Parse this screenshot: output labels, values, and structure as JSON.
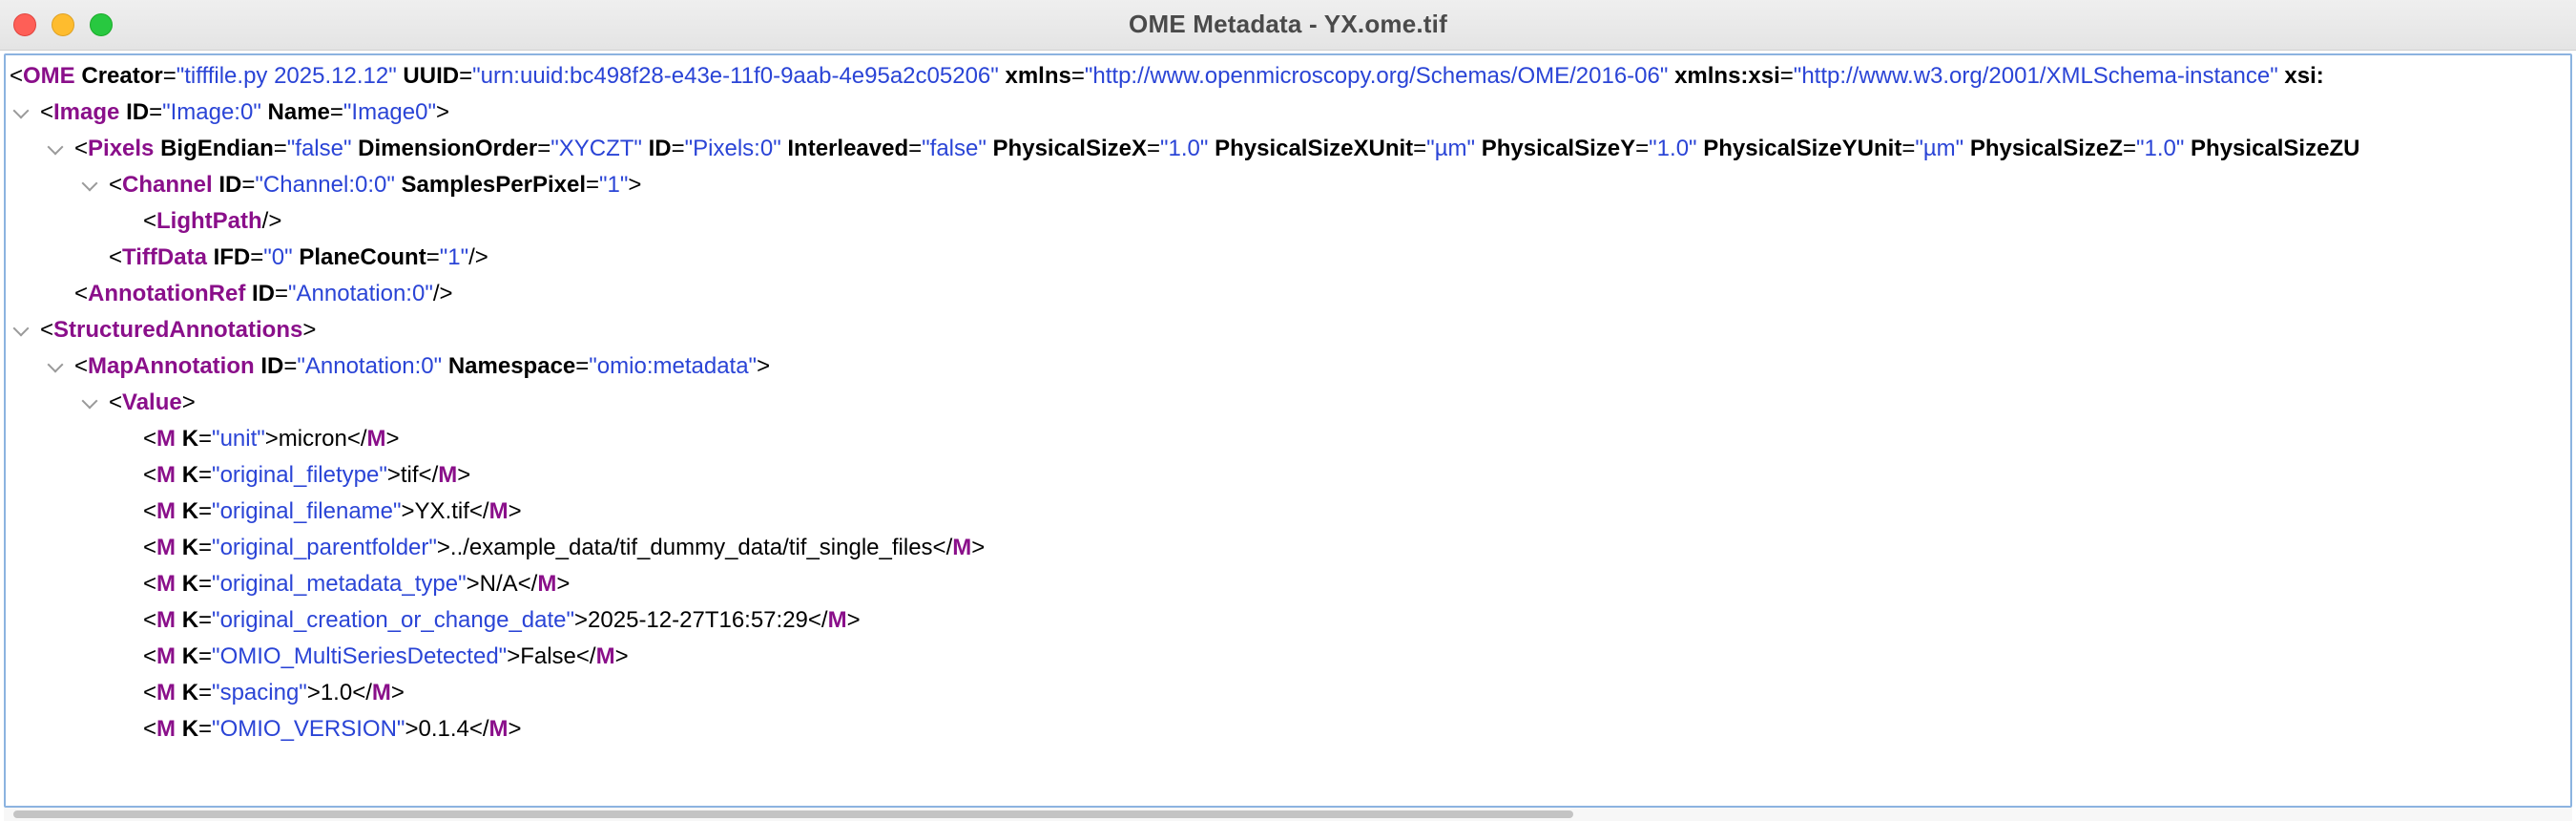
{
  "window": {
    "title": "OME Metadata - YX.ome.tif"
  },
  "icons": {
    "expand": "chevron-down-icon"
  },
  "colors": {
    "tag": "#8a0f8a",
    "attr_value": "#2a44d6",
    "focus_border": "#8cb3e0"
  },
  "tree": {
    "ome": {
      "name": "OME",
      "creator_attr": "Creator",
      "creator_val": "\"tifffile.py 2025.12.12\"",
      "uuid_attr": "UUID",
      "uuid_val": "\"urn:uuid:bc498f28-e43e-11f0-9aab-4e95a2c05206\"",
      "xmlns_attr": "xmlns",
      "xmlns_val": "\"http://www.openmicroscopy.org/Schemas/OME/2016-06\"",
      "xmlnsxsi_attr": "xmlns:xsi",
      "xmlnsxsi_val": "\"http://www.w3.org/2001/XMLSchema-instance\"",
      "xsi_attr": "xsi:"
    },
    "image": {
      "name": "Image",
      "id_attr": "ID",
      "id_val": "\"Image:0\"",
      "name_attr": "Name",
      "name_val": "\"Image0\""
    },
    "pixels": {
      "name": "Pixels",
      "bigendian_attr": "BigEndian",
      "bigendian_val": "\"false\"",
      "dimorder_attr": "DimensionOrder",
      "dimorder_val": "\"XYCZT\"",
      "id_attr": "ID",
      "id_val": "\"Pixels:0\"",
      "interleaved_attr": "Interleaved",
      "interleaved_val": "\"false\"",
      "psx_attr": "PhysicalSizeX",
      "psx_val": "\"1.0\"",
      "psxu_attr": "PhysicalSizeXUnit",
      "psxu_val": "\"µm\"",
      "psy_attr": "PhysicalSizeY",
      "psy_val": "\"1.0\"",
      "psyu_attr": "PhysicalSizeYUnit",
      "psyu_val": "\"µm\"",
      "psz_attr": "PhysicalSizeZ",
      "psz_val": "\"1.0\"",
      "pszu_attr": "PhysicalSizeZU"
    },
    "channel": {
      "name": "Channel",
      "id_attr": "ID",
      "id_val": "\"Channel:0:0\"",
      "spp_attr": "SamplesPerPixel",
      "spp_val": "\"1\""
    },
    "lightpath": {
      "name": "LightPath"
    },
    "tiffdata": {
      "name": "TiffData",
      "ifd_attr": "IFD",
      "ifd_val": "\"0\"",
      "pc_attr": "PlaneCount",
      "pc_val": "\"1\""
    },
    "annotationref": {
      "name": "AnnotationRef",
      "id_attr": "ID",
      "id_val": "\"Annotation:0\""
    },
    "structured": {
      "name": "StructuredAnnotations"
    },
    "mapannotation": {
      "name": "MapAnnotation",
      "id_attr": "ID",
      "id_val": "\"Annotation:0\"",
      "ns_attr": "Namespace",
      "ns_val": "\"omio:metadata\""
    },
    "value": {
      "name": "Value"
    },
    "m_entries": [
      {
        "tag": "M",
        "k_attr": "K",
        "k": "\"unit\"",
        "text": "micron"
      },
      {
        "tag": "M",
        "k_attr": "K",
        "k": "\"original_filetype\"",
        "text": "tif"
      },
      {
        "tag": "M",
        "k_attr": "K",
        "k": "\"original_filename\"",
        "text": "YX.tif"
      },
      {
        "tag": "M",
        "k_attr": "K",
        "k": "\"original_parentfolder\"",
        "text": "../example_data/tif_dummy_data/tif_single_files"
      },
      {
        "tag": "M",
        "k_attr": "K",
        "k": "\"original_metadata_type\"",
        "text": "N/A"
      },
      {
        "tag": "M",
        "k_attr": "K",
        "k": "\"original_creation_or_change_date\"",
        "text": "2025-12-27T16:57:29"
      },
      {
        "tag": "M",
        "k_attr": "K",
        "k": "\"OMIO_MultiSeriesDetected\"",
        "text": "False"
      },
      {
        "tag": "M",
        "k_attr": "K",
        "k": "\"spacing\"",
        "text": "1.0"
      },
      {
        "tag": "M",
        "k_attr": "K",
        "k": "\"OMIO_VERSION\"",
        "text": "0.1.4"
      }
    ]
  }
}
